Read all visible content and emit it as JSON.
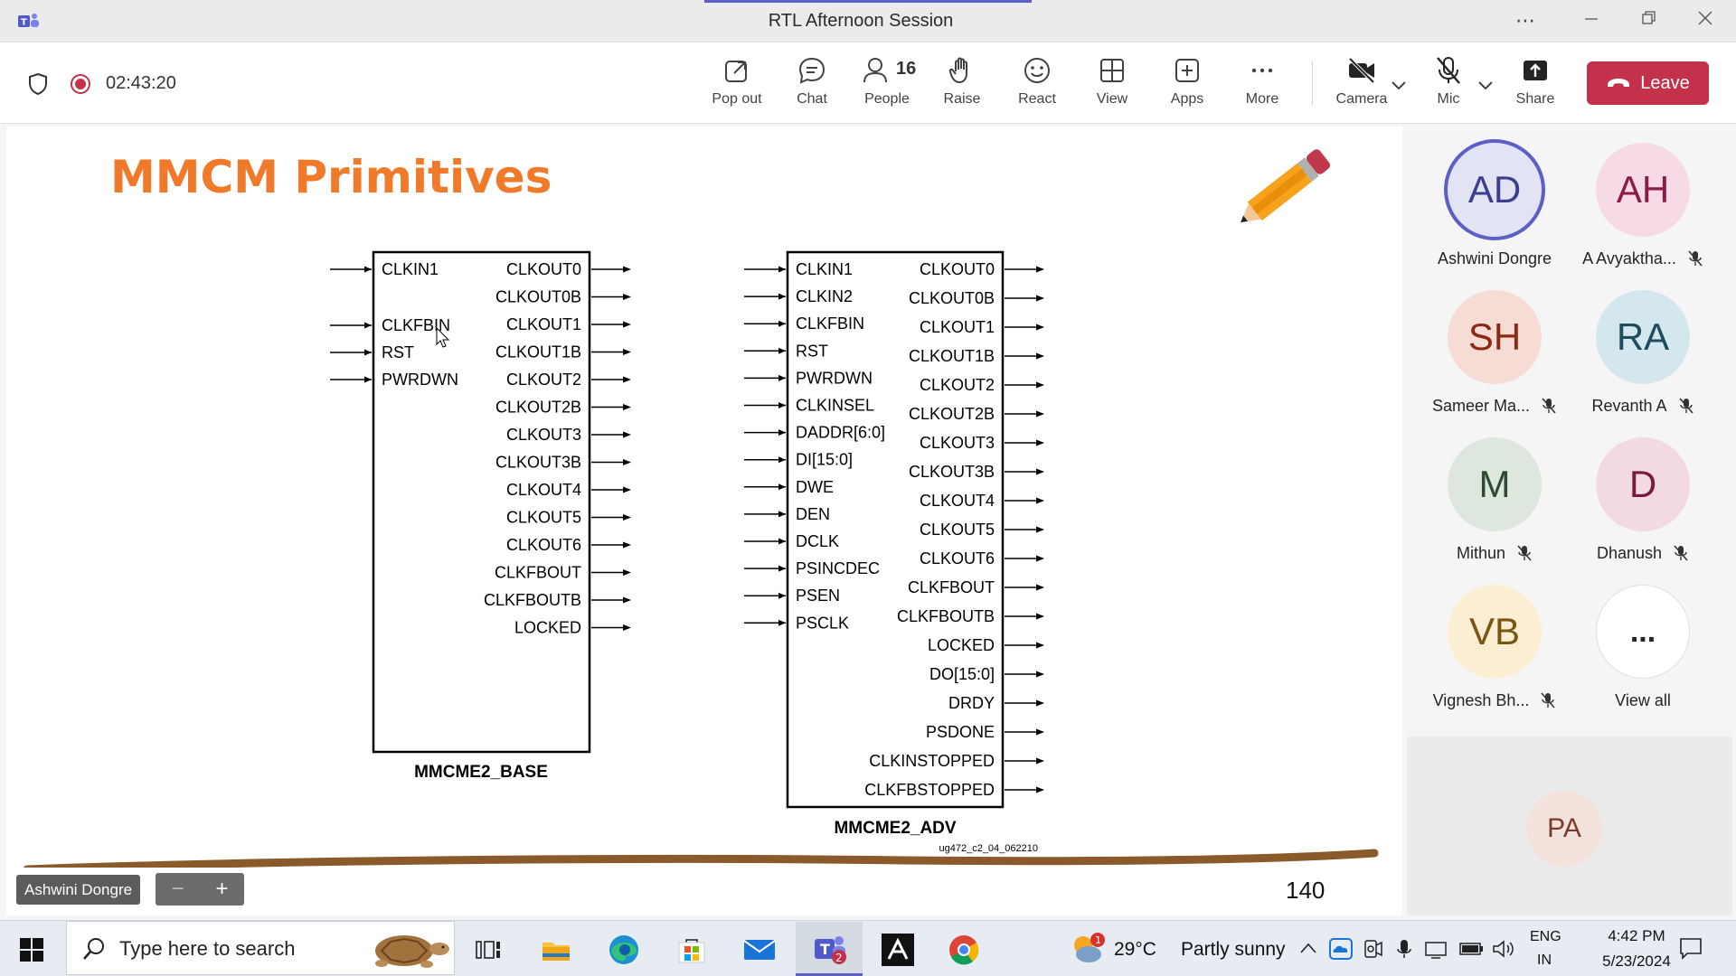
{
  "window": {
    "title": "RTL Afternoon Session"
  },
  "meeting": {
    "timer": "02:43:20"
  },
  "toolbar": {
    "popout": "Pop out",
    "chat": "Chat",
    "people": "People",
    "people_count": "16",
    "raise": "Raise",
    "react": "React",
    "view": "View",
    "apps": "Apps",
    "more": "More",
    "camera": "Camera",
    "mic": "Mic",
    "share": "Share",
    "leave": "Leave",
    "leave_color": "#c4314b"
  },
  "slide": {
    "title": "MMCM Primitives",
    "base": {
      "name": "MMCME2_BASE",
      "inputs": [
        "CLKIN1",
        "CLKFBIN",
        "RST",
        "PWRDWN"
      ],
      "outputs": [
        "CLKOUT0",
        "CLKOUT0B",
        "CLKOUT1",
        "CLKOUT1B",
        "CLKOUT2",
        "CLKOUT2B",
        "CLKOUT3",
        "CLKOUT3B",
        "CLKOUT4",
        "CLKOUT5",
        "CLKOUT6",
        "CLKFBOUT",
        "CLKFBOUTB",
        "LOCKED"
      ]
    },
    "adv": {
      "name": "MMCME2_ADV",
      "inputs": [
        "CLKIN1",
        "CLKIN2",
        "CLKFBIN",
        "RST",
        "PWRDWN",
        "CLKINSEL",
        "DADDR[6:0]",
        "DI[15:0]",
        "DWE",
        "DEN",
        "DCLK",
        "PSINCDEC",
        "PSEN",
        "PSCLK"
      ],
      "outputs": [
        "CLKOUT0",
        "CLKOUT0B",
        "CLKOUT1",
        "CLKOUT1B",
        "CLKOUT2",
        "CLKOUT2B",
        "CLKOUT3",
        "CLKOUT3B",
        "CLKOUT4",
        "CLKOUT5",
        "CLKOUT6",
        "CLKFBOUT",
        "CLKFBOUTB",
        "LOCKED",
        "DO[15:0]",
        "DRDY",
        "PSDONE",
        "CLKINSTOPPED",
        "CLKFBSTOPPED"
      ]
    },
    "figure_ref": "ug472_c2_04_062210",
    "page_number": "140",
    "accent_color": "#f07a2a"
  },
  "presenter": {
    "name_tag": "Ashwini Dongre",
    "zoom_out": "−",
    "zoom_in": "+"
  },
  "participants": [
    {
      "initials": "AD",
      "name": "Ashwini Dongre",
      "muted": false,
      "bg": "#e2e3f4",
      "fg": "#3b3f8f",
      "speaking": true
    },
    {
      "initials": "AH",
      "name": "A Avyaktha...",
      "muted": true,
      "bg": "#f6dbe6",
      "fg": "#8a1c4a"
    },
    {
      "initials": "SH",
      "name": "Sameer Ma...",
      "muted": true,
      "bg": "#f6dcd5",
      "fg": "#8a2a15"
    },
    {
      "initials": "RA",
      "name": "Revanth A",
      "muted": true,
      "bg": "#d5e7ee",
      "fg": "#1d4c5c"
    },
    {
      "initials": "M",
      "name": "Mithun",
      "muted": true,
      "bg": "#dde7dd",
      "fg": "#2e4a33"
    },
    {
      "initials": "D",
      "name": "Dhanush",
      "muted": true,
      "bg": "#f3d9e2",
      "fg": "#7a1b3e"
    },
    {
      "initials": "VB",
      "name": "Vignesh Bh...",
      "muted": true,
      "bg": "#fbeed3",
      "fg": "#7a5412"
    },
    {
      "initials": "...",
      "name": "View all",
      "muted": false,
      "bg": "#ffffff",
      "fg": "#242424"
    }
  ],
  "extra_participant": {
    "initials": "PA",
    "bg": "#f4e2dc",
    "fg": "#7a3b2a"
  },
  "taskbar": {
    "search_placeholder": "Type here to search",
    "teams_badge": "2",
    "weather_temp": "29°C",
    "weather_text": "Partly sunny",
    "weather_badge": "1",
    "lang1": "ENG",
    "lang2": "IN",
    "time": "4:42 PM",
    "date": "5/23/2024"
  }
}
